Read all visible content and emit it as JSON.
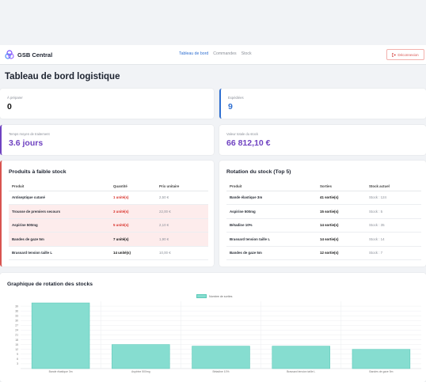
{
  "app": {
    "name": "GSB Central"
  },
  "nav": {
    "links": [
      "Tableau de bord",
      "Commandes",
      "Stock"
    ],
    "logout_label": "Déconnexion"
  },
  "page_title": "Tableau de bord logistique",
  "stats": {
    "to_prepare": {
      "label": "À préparer",
      "value": "0"
    },
    "shipped": {
      "label": "Expédiées",
      "value": "9"
    },
    "avg_time": {
      "label": "Temps moyen de traitement",
      "value": "3.6 jours"
    },
    "stock_value": {
      "label": "Valeur totale du stock",
      "value": "66 812,10 €"
    }
  },
  "low_stock": {
    "title": "Produits à faible stock",
    "headers": [
      "Produit",
      "Quantité",
      "Prix unitaire"
    ],
    "rows": [
      {
        "product": "Antiseptique cutané",
        "qty": "1 unité(s)",
        "price": "2,50 €",
        "alert": false,
        "low": true
      },
      {
        "product": "Trousse de premiers secours",
        "qty": "3 unité(s)",
        "price": "22,00 €",
        "alert": true,
        "low": true
      },
      {
        "product": "Aspirine 500mg",
        "qty": "5 unité(s)",
        "price": "2,10 €",
        "alert": true,
        "low": true
      },
      {
        "product": "Bandes de gaze 5m",
        "qty": "7 unité(s)",
        "price": "1,90 €",
        "alert": true,
        "low": false
      },
      {
        "product": "Brassard tension taille L",
        "qty": "14 unité(s)",
        "price": "10,00 €",
        "alert": false,
        "low": false
      }
    ]
  },
  "rotation": {
    "title": "Rotation du stock (Top 5)",
    "headers": [
      "Produit",
      "Sorties",
      "Stock actuel"
    ],
    "rows": [
      {
        "product": "Bande élastique 3m",
        "sorties": "41 sortie(s)",
        "stock": "Stock : 124"
      },
      {
        "product": "Aspirine 500mg",
        "sorties": "15 sortie(s)",
        "stock": "Stock : 5"
      },
      {
        "product": "Bétadine 10%",
        "sorties": "14 sortie(s)",
        "stock": "Stock : 35"
      },
      {
        "product": "Brassard tension taille L",
        "sorties": "14 sortie(s)",
        "stock": "Stock : 14"
      },
      {
        "product": "Bandes de gaze 5m",
        "sorties": "12 sortie(s)",
        "stock": "Stock : 7"
      }
    ]
  },
  "chart_panel": {
    "title": "Graphique de rotation des stocks"
  },
  "chart_data": {
    "type": "bar",
    "categories": [
      "Bande élastique 3m",
      "Aspirine 500mg",
      "Bétadine 10%",
      "Brassard tension taille L",
      "Bandes de gaze 5m"
    ],
    "series": [
      {
        "name": "Nombre de sorties",
        "values": [
          41,
          15,
          14,
          14,
          12
        ]
      }
    ],
    "yticks": [
      3,
      6,
      9,
      12,
      15,
      18,
      21,
      24,
      27,
      30,
      33,
      36,
      39
    ],
    "ylim": [
      0,
      42
    ],
    "grid": true,
    "legend": "top-center",
    "colors": {
      "bar_fill": "#86ddd0",
      "bar_stroke": "#5ccab9"
    }
  },
  "colors": {
    "accent_blue": "#2f6fd1",
    "accent_purple": "#6f42c1",
    "danger": "#d9534f"
  }
}
